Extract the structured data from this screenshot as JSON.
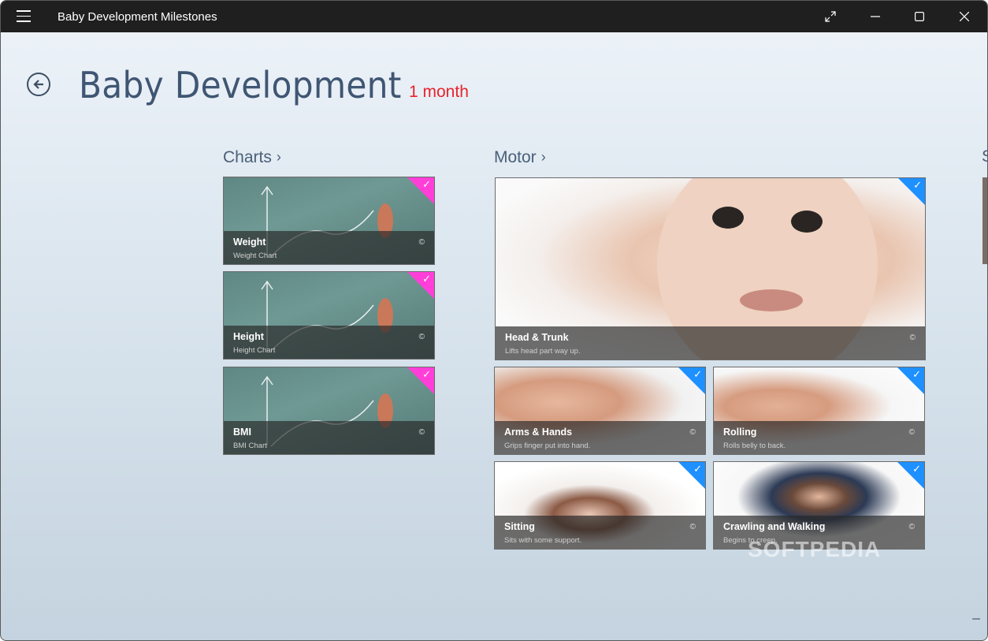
{
  "window": {
    "title": "Baby Development Milestones"
  },
  "header": {
    "title": "Baby Development",
    "age": "1 month"
  },
  "groups": {
    "charts": {
      "title": "Charts",
      "tiles": [
        {
          "title": "Weight",
          "subtitle": "Weight Chart",
          "checked": true
        },
        {
          "title": "Height",
          "subtitle": "Height Chart",
          "checked": true
        },
        {
          "title": "BMI",
          "subtitle": "BMI Chart",
          "checked": true
        }
      ]
    },
    "motor": {
      "title": "Motor",
      "tiles": [
        {
          "title": "Head & Trunk",
          "subtitle": "Lifts head part way up.",
          "checked": true
        },
        {
          "title": "Arms & Hands",
          "subtitle": "Grips finger put into hand.",
          "checked": true
        },
        {
          "title": "Rolling",
          "subtitle": "Rolls belly to back.",
          "checked": true
        },
        {
          "title": "Sitting",
          "subtitle": "Sits with some support.",
          "checked": true
        },
        {
          "title": "Crawling and Walking",
          "subtitle": "Begins to creep.",
          "checked": true
        }
      ]
    },
    "next_partial": {
      "title": "S"
    }
  },
  "glyphs": {
    "chevron": "›",
    "copyright": "©",
    "check": "✓"
  },
  "colors": {
    "accent_red": "#e8232b",
    "check_blue": "#1e90ff",
    "check_pink": "#ff3fd8",
    "title_blue": "#3f5673"
  },
  "watermark": "SOFTPEDIA"
}
